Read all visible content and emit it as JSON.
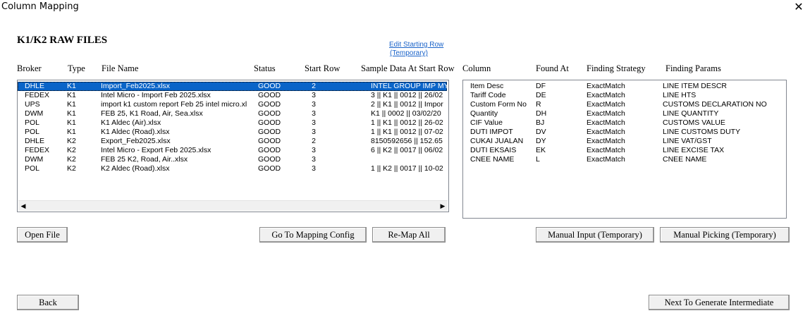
{
  "window": {
    "title": "Column Mapping",
    "close_glyph": "✕"
  },
  "heading": "K1/K2 RAW FILES",
  "edit_link": {
    "line1": "Edit Starting Row",
    "line2": "(Temporary)"
  },
  "files": {
    "headers": {
      "broker": "Broker",
      "type": "Type",
      "file_name": "File Name",
      "status": "Status",
      "start_row": "Start Row",
      "sample": "Sample Data At Start Row"
    },
    "rows": [
      {
        "broker": "DHLE",
        "type": "K1",
        "file": "Import_Feb2025.xlsx",
        "status": "GOOD",
        "start": "2",
        "sample": "INTEL GROUP IMP MY"
      },
      {
        "broker": "FEDEX",
        "type": "K1",
        "file": "Intel Micro - Import Feb 2025.xlsx",
        "status": "GOOD",
        "start": "3",
        "sample": "3 || K1 || 0012 || 26/02"
      },
      {
        "broker": "UPS",
        "type": "K1",
        "file": "import k1 custom report Feb 25 intel micro.xl",
        "status": "GOOD",
        "start": "3",
        "sample": "2 || K1 || 0012 || Impor"
      },
      {
        "broker": "DWM",
        "type": "K1",
        "file": "FEB 25, K1 Road, Air, Sea.xlsx",
        "status": "GOOD",
        "start": "3",
        "sample": "K1 || 0002 || 03/02/20"
      },
      {
        "broker": "POL",
        "type": "K1",
        "file": "K1 Aldec (Air).xlsx",
        "status": "GOOD",
        "start": "3",
        "sample": "1 || K1 || 0012 || 26-02"
      },
      {
        "broker": "POL",
        "type": "K1",
        "file": "K1 Aldec (Road).xlsx",
        "status": "GOOD",
        "start": "3",
        "sample": "1 || K1 || 0012 || 07-02"
      },
      {
        "broker": "DHLE",
        "type": "K2",
        "file": "Export_Feb2025.xlsx",
        "status": "GOOD",
        "start": "2",
        "sample": "8150592656 || 152.65"
      },
      {
        "broker": "FEDEX",
        "type": "K2",
        "file": "Intel Micro - Export Feb 2025.xlsx",
        "status": "GOOD",
        "start": "3",
        "sample": "6 || K2 || 0017 || 06/02"
      },
      {
        "broker": "DWM",
        "type": "K2",
        "file": "FEB 25 K2, Road, Air..xlsx",
        "status": "GOOD",
        "start": "3",
        "sample": ""
      },
      {
        "broker": "POL",
        "type": "K2",
        "file": "K2 Aldec (Road).xlsx",
        "status": "GOOD",
        "start": "3",
        "sample": "1 || K2 || 0017 || 10-02"
      }
    ]
  },
  "mapping": {
    "headers": {
      "column": "Column",
      "found_at": "Found At",
      "strategy": "Finding Strategy",
      "params": "Finding Params"
    },
    "rows": [
      {
        "column": "Item Desc",
        "found": "DF",
        "strategy": "ExactMatch",
        "params": "LINE ITEM DESCR"
      },
      {
        "column": "Tariff Code",
        "found": "DE",
        "strategy": "ExactMatch",
        "params": "LINE HTS"
      },
      {
        "column": "Custom Form No",
        "found": "R",
        "strategy": "ExactMatch",
        "params": "CUSTOMS DECLARATION NO"
      },
      {
        "column": "Quantity",
        "found": "DH",
        "strategy": "ExactMatch",
        "params": "LINE QUANTITY"
      },
      {
        "column": "CIF Value",
        "found": "BJ",
        "strategy": "ExactMatch",
        "params": "CUSTOMS VALUE"
      },
      {
        "column": "DUTI IMPOT",
        "found": "DV",
        "strategy": "ExactMatch",
        "params": "LINE CUSTOMS DUTY"
      },
      {
        "column": "CUKAI JUALAN",
        "found": "DY",
        "strategy": "ExactMatch",
        "params": "LINE VAT/GST"
      },
      {
        "column": "DUTI EKSAIS",
        "found": "EK",
        "strategy": "ExactMatch",
        "params": "LINE EXCISE TAX"
      },
      {
        "column": "CNEE NAME",
        "found": "L",
        "strategy": "ExactMatch",
        "params": "CNEE NAME"
      }
    ]
  },
  "buttons": {
    "open_file": "Open File",
    "go_to_mapping": "Go To Mapping Config",
    "remap_all": "Re-Map All",
    "manual_input": "Manual Input (Temporary)",
    "manual_picking": "Manual Picking (Temporary)",
    "back": "Back",
    "next": "Next To Generate Intermediate"
  },
  "scroll": {
    "left_arrow": "◀",
    "right_arrow": "▶"
  },
  "colors": {
    "selection": "#0a64c8",
    "link": "#1a63c9",
    "button_face": "#f0f0f0"
  }
}
